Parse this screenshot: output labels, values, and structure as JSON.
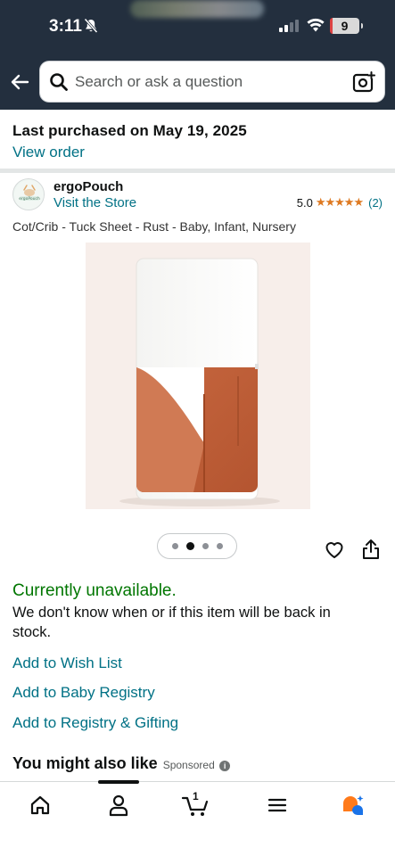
{
  "status_bar": {
    "time": "3:11",
    "battery": "9",
    "battery_level_percent": 9
  },
  "header": {
    "search_placeholder": "Search or ask a question",
    "back_icon": "arrow-left-icon",
    "camera_icon": "camera-lens-icon",
    "background_color": "#232f3e"
  },
  "order": {
    "last_purchased": "Last purchased on May 19, 2025",
    "view_order": "View order"
  },
  "product": {
    "brand": "ergoPouch",
    "visit_store": "Visit the Store",
    "rating_value": "5.0",
    "stars": "★★★★★",
    "rating_count": "(2)",
    "title": "Cot/Crib - Tuck Sheet - Rust - Baby, Infant, Nursery",
    "image_count": 4,
    "active_image_index": 2
  },
  "availability": {
    "status": "Currently unavailable.",
    "message": "We don't know when or if this item will be back in stock.",
    "status_color": "#007600"
  },
  "actions": {
    "wish_list": "Add to Wish List",
    "baby_registry": "Add to Baby Registry",
    "registry_gifting": "Add to Registry & Gifting"
  },
  "recommendations": {
    "heading": "You might also like",
    "sponsored": "Sponsored"
  },
  "bottom_nav": {
    "cart_count": "1",
    "items": [
      "home-icon",
      "account-icon",
      "cart-icon",
      "menu-icon",
      "rufus-assistant-icon"
    ]
  },
  "colors": {
    "link": "#007185",
    "star": "#de7921"
  }
}
